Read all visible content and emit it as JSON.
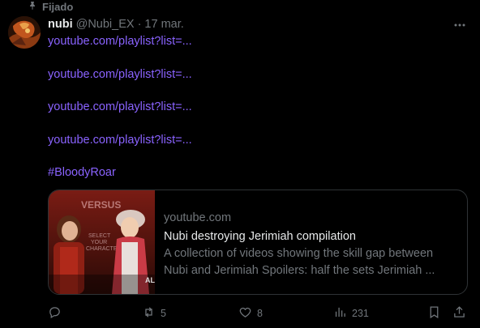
{
  "pinned": {
    "label": "Fijado",
    "icon": "pin-icon"
  },
  "author": {
    "name": "nubi",
    "handle": "@Nubi_EX",
    "separator": "·",
    "date": "17 mar."
  },
  "post": {
    "links": [
      "youtube.com/playlist?list=...",
      "youtube.com/playlist?list=...",
      "youtube.com/playlist?list=...",
      "youtube.com/playlist?list=..."
    ],
    "hashtag": "#BloodyRoar"
  },
  "card": {
    "domain": "youtube.com",
    "title": "Nubi destroying Jerimiah compilation",
    "description_line1": "A collection of videos showing the skill gap between",
    "description_line2": "Nubi and Jerimiah Spoilers: half the sets Jerimiah ...",
    "thumbnail_text": {
      "versus": "VERSUS",
      "select1": "SELECT",
      "select2": "YOUR",
      "select3": "CHARACTER",
      "corner": "AL"
    }
  },
  "actions": {
    "reply": {
      "icon": "reply-icon",
      "count": ""
    },
    "repost": {
      "icon": "repost-icon",
      "count": "5"
    },
    "like": {
      "icon": "heart-icon",
      "count": "8"
    },
    "views": {
      "icon": "analytics-icon",
      "count": "231"
    },
    "bookmark": {
      "icon": "bookmark-icon"
    },
    "share": {
      "icon": "share-icon"
    }
  },
  "colors": {
    "link": "#8a63ff",
    "muted": "#71767b",
    "text": "#e7e9ea",
    "background": "#000000",
    "border": "#2f3336"
  }
}
